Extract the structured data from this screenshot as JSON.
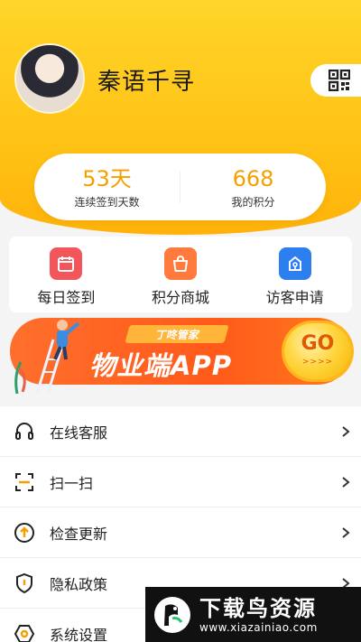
{
  "profile": {
    "username": "秦语千寻",
    "qr_icon": "qr-code-icon"
  },
  "stats": {
    "checkin_days": "53天",
    "checkin_label": "连续签到天数",
    "points": "668",
    "points_label": "我的积分"
  },
  "quick_actions": [
    {
      "label": "每日签到",
      "icon": "calendar-icon",
      "color": "#f2555a"
    },
    {
      "label": "积分商城",
      "icon": "shopping-bag-icon",
      "color": "#ff7a3c"
    },
    {
      "label": "访客申请",
      "icon": "visitor-key-icon",
      "color": "#2d7ff0"
    }
  ],
  "banner": {
    "tag": "丁咚管家",
    "title": "物业端APP",
    "go": "GO",
    "go_arrows": ">>>>"
  },
  "menu": [
    {
      "label": "在线客服",
      "icon": "headset-icon"
    },
    {
      "label": "扫一扫",
      "icon": "scan-icon"
    },
    {
      "label": "检查更新",
      "icon": "update-arrow-icon"
    },
    {
      "label": "隐私政策",
      "icon": "shield-icon"
    },
    {
      "label": "系统设置",
      "icon": "settings-icon"
    }
  ],
  "watermark": {
    "title": "下载鸟资源",
    "url": "www.xiazainiao.com"
  },
  "colors": {
    "header_yellow": "#ffc21a",
    "accent_orange": "#f5a000",
    "banner_orange": "#ff5a1a"
  }
}
